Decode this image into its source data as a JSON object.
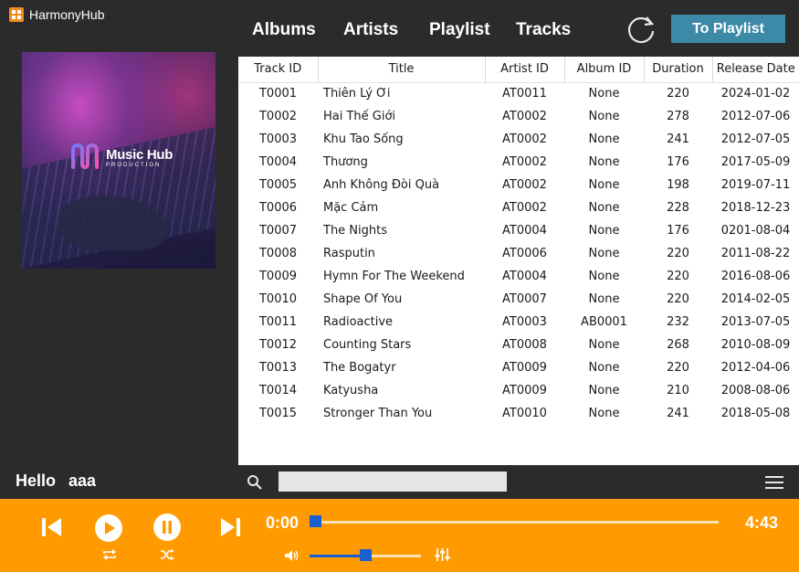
{
  "app": {
    "title": "HarmonyHub"
  },
  "cover": {
    "brand_name": "Music Hub",
    "brand_sub": "PRODUCTION"
  },
  "user": {
    "greeting": "Hello",
    "name": "aaa"
  },
  "nav": {
    "albums": "Albums",
    "artists": "Artists",
    "playlist": "Playlist",
    "tracks": "Tracks"
  },
  "actions": {
    "to_playlist": "To Playlist"
  },
  "table": {
    "columns": [
      "Track ID",
      "Title",
      "Artist ID",
      "Album ID",
      "Duration",
      "Release Date"
    ],
    "rows": [
      [
        "T0001",
        "Thiên Lý Ơi",
        "AT0011",
        "None",
        "220",
        "2024-01-02"
      ],
      [
        "T0002",
        "Hai Thế Giới",
        "AT0002",
        "None",
        "278",
        "2012-07-06"
      ],
      [
        "T0003",
        "Khu Tao Sống",
        "AT0002",
        "None",
        "241",
        "2012-07-05"
      ],
      [
        "T0004",
        "Thương",
        "AT0002",
        "None",
        "176",
        "2017-05-09"
      ],
      [
        "T0005",
        "Anh Không Đòi Quà",
        "AT0002",
        "None",
        "198",
        "2019-07-11"
      ],
      [
        "T0006",
        "Mặc Cảm",
        "AT0002",
        "None",
        "228",
        "2018-12-23"
      ],
      [
        "T0007",
        "The Nights",
        "AT0004",
        "None",
        "176",
        "0201-08-04"
      ],
      [
        "T0008",
        "Rasputin",
        "AT0006",
        "None",
        "220",
        "2011-08-22"
      ],
      [
        "T0009",
        "Hymn For The Weekend",
        "AT0004",
        "None",
        "220",
        "2016-08-06"
      ],
      [
        "T0010",
        "Shape Of You",
        "AT0007",
        "None",
        "220",
        "2014-02-05"
      ],
      [
        "T0011",
        "Radioactive",
        "AT0003",
        "AB0001",
        "232",
        "2013-07-05"
      ],
      [
        "T0012",
        "Counting Stars",
        "AT0008",
        "None",
        "268",
        "2010-08-09"
      ],
      [
        "T0013",
        "The Bogatyr",
        "AT0009",
        "None",
        "220",
        "2012-04-06"
      ],
      [
        "T0014",
        "Katyusha",
        "AT0009",
        "None",
        "210",
        "2008-08-06"
      ],
      [
        "T0015",
        "Stronger Than You",
        "AT0010",
        "None",
        "241",
        "2018-05-08"
      ]
    ]
  },
  "search": {
    "value": ""
  },
  "player": {
    "current_time": "0:00",
    "total_time": "4:43",
    "progress": 0.0,
    "volume": 0.5
  },
  "colors": {
    "background": "#2b2b2b",
    "player_bar": "#ff9a00",
    "accent_button": "#3d8aa8",
    "slider": "#1a5fd0"
  },
  "icons": [
    "app-logo-icon",
    "refresh-icon",
    "search-icon",
    "menu-icon",
    "previous-icon",
    "play-icon",
    "pause-icon",
    "next-icon",
    "repeat-icon",
    "shuffle-icon",
    "volume-icon",
    "equalizer-icon"
  ]
}
